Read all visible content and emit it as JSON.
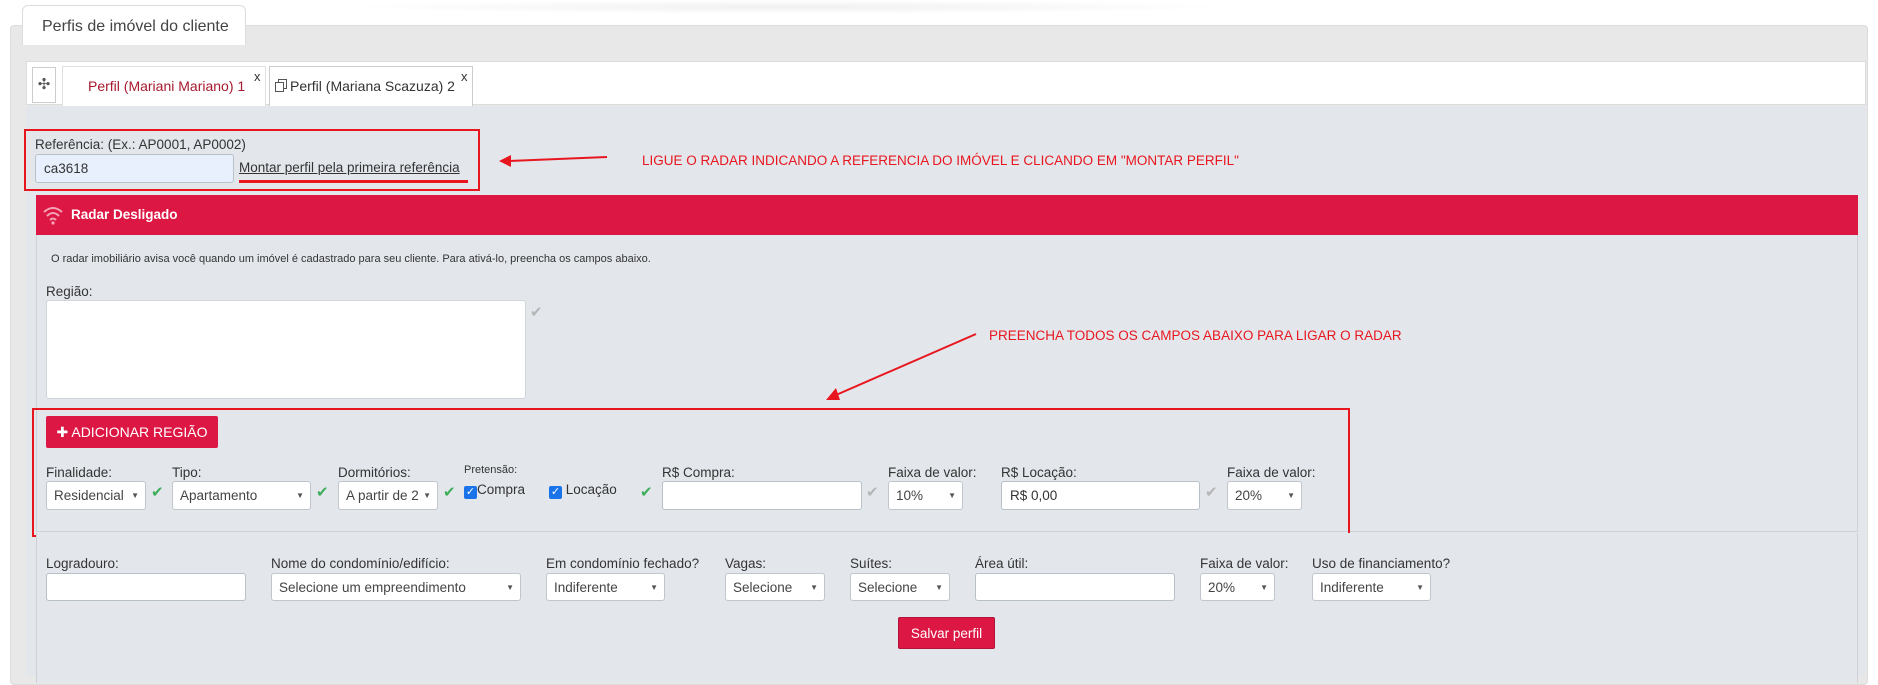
{
  "page_title": "Perfis de imóvel do cliente",
  "tabs": [
    {
      "label": "Perfil (Mariani Mariano) 1",
      "close": "x"
    },
    {
      "label": "Perfil (Mariana Scazuza) 2",
      "close": "x"
    }
  ],
  "tab_add_icon": "✣",
  "reference": {
    "label": "Referência: (Ex.: AP0001, AP0002)",
    "value": "ca3618",
    "link": "Montar perfil pela primeira referência"
  },
  "annotations": {
    "reference": "LIGUE O RADAR INDICANDO A REFERENCIA DO IMÓVEL E CLICANDO EM \"MONTAR PERFIL\"",
    "fields": "PREENCHA TODOS OS CAMPOS ABAIXO PARA LIGAR O RADAR"
  },
  "radar": {
    "title": "Radar Desligado",
    "description": "O radar imobiliário avisa você quando um imóvel é cadastrado para seu cliente. Para ativá-lo, preencha os campos abaixo.",
    "region_label": "Região:",
    "add_region_button": "ADICIONAR REGIÃO",
    "plus_icon": "✚"
  },
  "filters": {
    "finalidade": {
      "label": "Finalidade:",
      "value": "Residencial"
    },
    "tipo": {
      "label": "Tipo:",
      "value": "Apartamento"
    },
    "dormitorios": {
      "label": "Dormitórios:",
      "value": "A partir de 2"
    },
    "pretensao": {
      "label": "Pretensão:",
      "compra": "Compra",
      "locacao": "Locação"
    },
    "compra": {
      "label": "R$ Compra:",
      "value": ""
    },
    "faixa_compra": {
      "label": "Faixa de valor:",
      "value": "10%"
    },
    "locacao": {
      "label": "R$ Locação:",
      "value": "R$ 0,00"
    },
    "faixa_locacao": {
      "label": "Faixa de valor:",
      "value": "20%"
    }
  },
  "extra": {
    "logradouro": {
      "label": "Logradouro:",
      "value": ""
    },
    "condominio": {
      "label": "Nome do condomínio/edifício:",
      "value": "Selecione um empreendimento"
    },
    "fechado": {
      "label": "Em condomínio fechado?",
      "value": "Indiferente"
    },
    "vagas": {
      "label": "Vagas:",
      "value": "Selecione"
    },
    "suites": {
      "label": "Suítes:",
      "value": "Selecione"
    },
    "area": {
      "label": "Área útil:",
      "value": ""
    },
    "faixa": {
      "label": "Faixa de valor:",
      "value": "20%"
    },
    "financiamento": {
      "label": "Uso de financiamento?",
      "value": "Indiferente"
    }
  },
  "save_button": "Salvar perfil",
  "colors": {
    "brand": "#dc1744",
    "annotation": "#e8161e",
    "check": "#3fae5a"
  }
}
